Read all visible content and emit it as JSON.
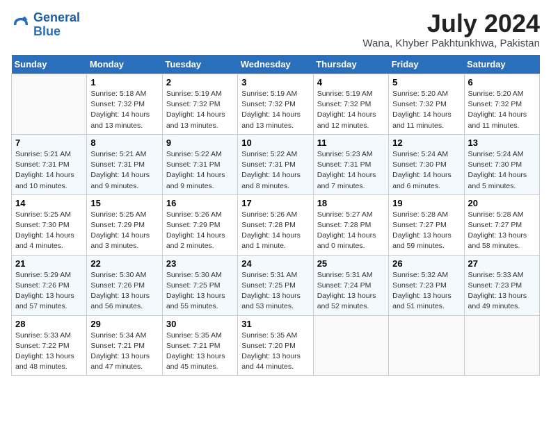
{
  "header": {
    "logo_line1": "General",
    "logo_line2": "Blue",
    "month_year": "July 2024",
    "location": "Wana, Khyber Pakhtunkhwa, Pakistan"
  },
  "days_of_week": [
    "Sunday",
    "Monday",
    "Tuesday",
    "Wednesday",
    "Thursday",
    "Friday",
    "Saturday"
  ],
  "weeks": [
    [
      {
        "num": "",
        "info": ""
      },
      {
        "num": "1",
        "info": "Sunrise: 5:18 AM\nSunset: 7:32 PM\nDaylight: 14 hours\nand 13 minutes."
      },
      {
        "num": "2",
        "info": "Sunrise: 5:19 AM\nSunset: 7:32 PM\nDaylight: 14 hours\nand 13 minutes."
      },
      {
        "num": "3",
        "info": "Sunrise: 5:19 AM\nSunset: 7:32 PM\nDaylight: 14 hours\nand 13 minutes."
      },
      {
        "num": "4",
        "info": "Sunrise: 5:19 AM\nSunset: 7:32 PM\nDaylight: 14 hours\nand 12 minutes."
      },
      {
        "num": "5",
        "info": "Sunrise: 5:20 AM\nSunset: 7:32 PM\nDaylight: 14 hours\nand 11 minutes."
      },
      {
        "num": "6",
        "info": "Sunrise: 5:20 AM\nSunset: 7:32 PM\nDaylight: 14 hours\nand 11 minutes."
      }
    ],
    [
      {
        "num": "7",
        "info": "Sunrise: 5:21 AM\nSunset: 7:31 PM\nDaylight: 14 hours\nand 10 minutes."
      },
      {
        "num": "8",
        "info": "Sunrise: 5:21 AM\nSunset: 7:31 PM\nDaylight: 14 hours\nand 9 minutes."
      },
      {
        "num": "9",
        "info": "Sunrise: 5:22 AM\nSunset: 7:31 PM\nDaylight: 14 hours\nand 9 minutes."
      },
      {
        "num": "10",
        "info": "Sunrise: 5:22 AM\nSunset: 7:31 PM\nDaylight: 14 hours\nand 8 minutes."
      },
      {
        "num": "11",
        "info": "Sunrise: 5:23 AM\nSunset: 7:31 PM\nDaylight: 14 hours\nand 7 minutes."
      },
      {
        "num": "12",
        "info": "Sunrise: 5:24 AM\nSunset: 7:30 PM\nDaylight: 14 hours\nand 6 minutes."
      },
      {
        "num": "13",
        "info": "Sunrise: 5:24 AM\nSunset: 7:30 PM\nDaylight: 14 hours\nand 5 minutes."
      }
    ],
    [
      {
        "num": "14",
        "info": "Sunrise: 5:25 AM\nSunset: 7:30 PM\nDaylight: 14 hours\nand 4 minutes."
      },
      {
        "num": "15",
        "info": "Sunrise: 5:25 AM\nSunset: 7:29 PM\nDaylight: 14 hours\nand 3 minutes."
      },
      {
        "num": "16",
        "info": "Sunrise: 5:26 AM\nSunset: 7:29 PM\nDaylight: 14 hours\nand 2 minutes."
      },
      {
        "num": "17",
        "info": "Sunrise: 5:26 AM\nSunset: 7:28 PM\nDaylight: 14 hours\nand 1 minute."
      },
      {
        "num": "18",
        "info": "Sunrise: 5:27 AM\nSunset: 7:28 PM\nDaylight: 14 hours\nand 0 minutes."
      },
      {
        "num": "19",
        "info": "Sunrise: 5:28 AM\nSunset: 7:27 PM\nDaylight: 13 hours\nand 59 minutes."
      },
      {
        "num": "20",
        "info": "Sunrise: 5:28 AM\nSunset: 7:27 PM\nDaylight: 13 hours\nand 58 minutes."
      }
    ],
    [
      {
        "num": "21",
        "info": "Sunrise: 5:29 AM\nSunset: 7:26 PM\nDaylight: 13 hours\nand 57 minutes."
      },
      {
        "num": "22",
        "info": "Sunrise: 5:30 AM\nSunset: 7:26 PM\nDaylight: 13 hours\nand 56 minutes."
      },
      {
        "num": "23",
        "info": "Sunrise: 5:30 AM\nSunset: 7:25 PM\nDaylight: 13 hours\nand 55 minutes."
      },
      {
        "num": "24",
        "info": "Sunrise: 5:31 AM\nSunset: 7:25 PM\nDaylight: 13 hours\nand 53 minutes."
      },
      {
        "num": "25",
        "info": "Sunrise: 5:31 AM\nSunset: 7:24 PM\nDaylight: 13 hours\nand 52 minutes."
      },
      {
        "num": "26",
        "info": "Sunrise: 5:32 AM\nSunset: 7:23 PM\nDaylight: 13 hours\nand 51 minutes."
      },
      {
        "num": "27",
        "info": "Sunrise: 5:33 AM\nSunset: 7:23 PM\nDaylight: 13 hours\nand 49 minutes."
      }
    ],
    [
      {
        "num": "28",
        "info": "Sunrise: 5:33 AM\nSunset: 7:22 PM\nDaylight: 13 hours\nand 48 minutes."
      },
      {
        "num": "29",
        "info": "Sunrise: 5:34 AM\nSunset: 7:21 PM\nDaylight: 13 hours\nand 47 minutes."
      },
      {
        "num": "30",
        "info": "Sunrise: 5:35 AM\nSunset: 7:21 PM\nDaylight: 13 hours\nand 45 minutes."
      },
      {
        "num": "31",
        "info": "Sunrise: 5:35 AM\nSunset: 7:20 PM\nDaylight: 13 hours\nand 44 minutes."
      },
      {
        "num": "",
        "info": ""
      },
      {
        "num": "",
        "info": ""
      },
      {
        "num": "",
        "info": ""
      }
    ]
  ]
}
